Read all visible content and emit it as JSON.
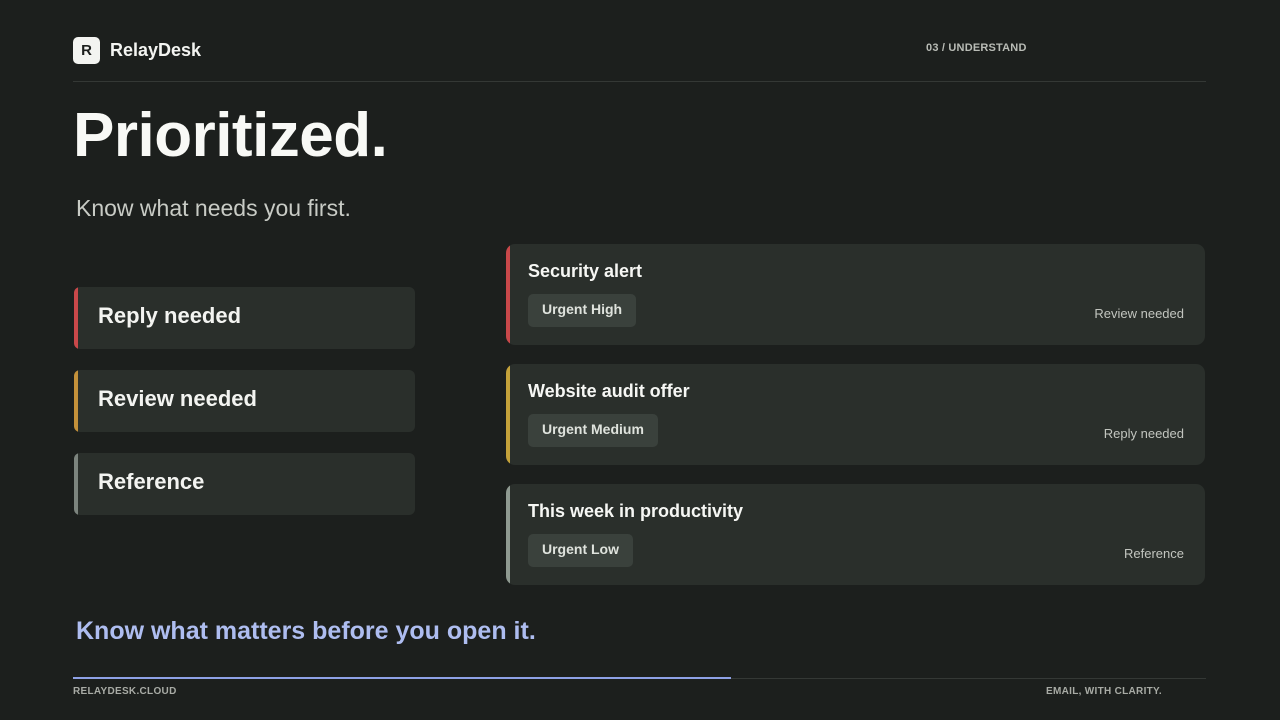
{
  "brand": {
    "logo_letter": "R",
    "name": "RelayDesk"
  },
  "section_label": "03 / UNDERSTAND",
  "headline": "Prioritized.",
  "subhead": "Know what needs you first.",
  "categories": [
    {
      "label": "Reply needed",
      "color": "#c9484a"
    },
    {
      "label": "Review needed",
      "color": "#c4913a"
    },
    {
      "label": "Reference",
      "color": "#7c847e"
    }
  ],
  "emails": [
    {
      "subject": "Security alert",
      "priority": "Urgent High",
      "tag": "Review needed",
      "color": "#c9484a"
    },
    {
      "subject": "Website audit offer",
      "priority": "Urgent Medium",
      "tag": "Reply needed",
      "color": "#c4a23a"
    },
    {
      "subject": "This week in productivity",
      "priority": "Urgent Low",
      "tag": "Reference",
      "color": "#8f9a91"
    }
  ],
  "tagline": "Know what matters before you open it.",
  "footer": {
    "left": "RELAYDESK.CLOUD",
    "right": "EMAIL, WITH CLARITY."
  },
  "colors": {
    "accent": "#8ea1e6",
    "background": "#1c1f1d",
    "card": "#2a2f2b"
  }
}
